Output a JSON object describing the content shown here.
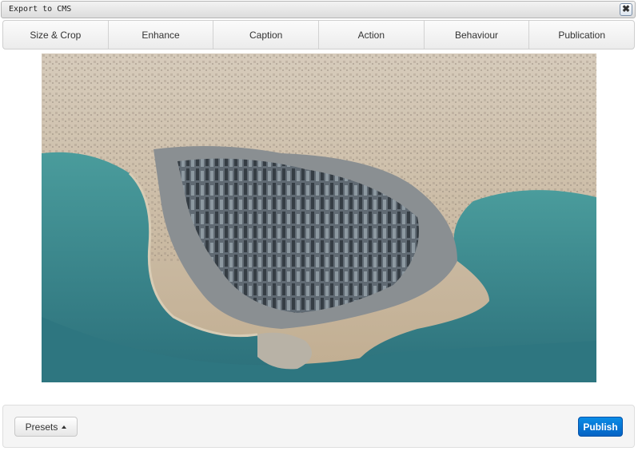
{
  "window": {
    "title": "Export to CMS",
    "close_symbol": "✖"
  },
  "tabs": [
    {
      "label": "Size & Crop"
    },
    {
      "label": "Enhance"
    },
    {
      "label": "Caption"
    },
    {
      "label": "Action"
    },
    {
      "label": "Behaviour"
    },
    {
      "label": "Publication"
    }
  ],
  "footer": {
    "presets_label": "Presets",
    "publish_label": "Publish"
  },
  "colors": {
    "publish_accent": "#0870d8",
    "water": "#3f8f92",
    "land": "#c9b9a1"
  },
  "icons": {
    "close": "close-icon",
    "caret": "caret-up-icon"
  }
}
